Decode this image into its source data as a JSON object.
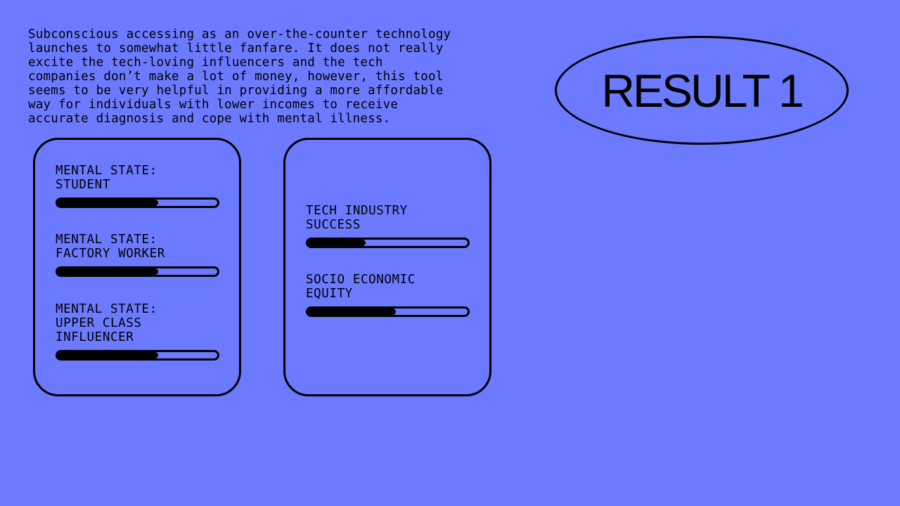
{
  "description": "Subconscious accessing as an over-the-counter technology\nlaunches to somewhat little fanfare. It does not really\nexcite the tech-loving influencers and the tech\ncompanies don’t make a lot of money, however, this tool\nseems to be very helpful in providing a more affordable\nway for individuals with lower incomes to receive\naccurate diagnosis and cope with mental illness.",
  "result": {
    "title": "RESULT 1"
  },
  "colors": {
    "background": "#6c7aff",
    "ink": "#000000"
  },
  "left_panel": {
    "metrics": [
      {
        "label": "MENTAL STATE:\nSTUDENT",
        "value_pct": 63
      },
      {
        "label": "MENTAL STATE:\nFACTORY WORKER",
        "value_pct": 63
      },
      {
        "label": "MENTAL STATE:\nUPPER CLASS\nINFLUENCER",
        "value_pct": 63
      }
    ]
  },
  "right_panel": {
    "metrics": [
      {
        "label": "TECH INDUSTRY\nSUCCESS",
        "value_pct": 36
      },
      {
        "label": "SOCIO ECONOMIC\nEQUITY",
        "value_pct": 55
      }
    ]
  }
}
